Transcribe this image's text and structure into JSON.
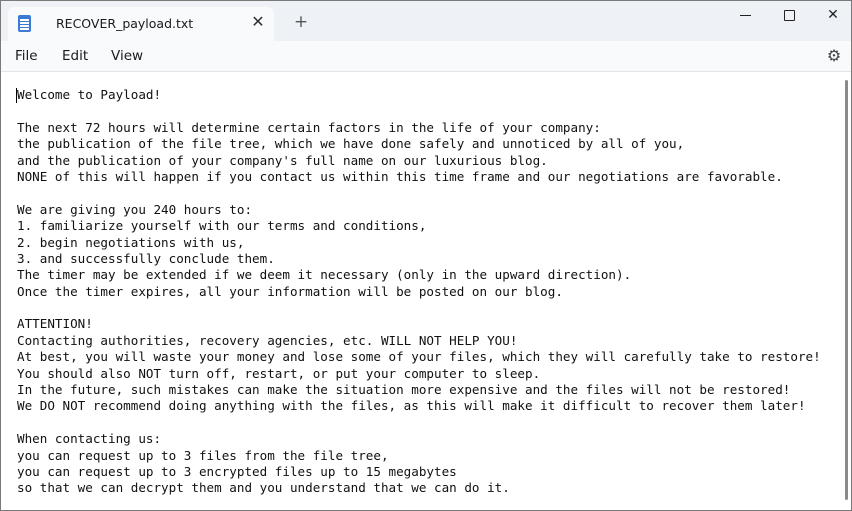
{
  "tab": {
    "title": "RECOVER_payload.txt",
    "close_glyph": "✕",
    "new_tab_glyph": "+"
  },
  "window_controls": {
    "close_glyph": "✕"
  },
  "menu": {
    "file": "File",
    "edit": "Edit",
    "view": "View",
    "settings_glyph": "⚙"
  },
  "document": {
    "lines": [
      "Welcome to Payload!",
      "",
      "The next 72 hours will determine certain factors in the life of your company:",
      "the publication of the file tree, which we have done safely and unnoticed by all of you,",
      "and the publication of your company's full name on our luxurious blog.",
      "NONE of this will happen if you contact us within this time frame and our negotiations are favorable.",
      "",
      "We are giving you 240 hours to:",
      "1. familiarize yourself with our terms and conditions,",
      "2. begin negotiations with us,",
      "3. and successfully conclude them.",
      "The timer may be extended if we deem it necessary (only in the upward direction).",
      "Once the timer expires, all your information will be posted on our blog.",
      "",
      "ATTENTION!",
      "Contacting authorities, recovery agencies, etc. WILL NOT HELP YOU!",
      "At best, you will waste your money and lose some of your files, which they will carefully take to restore!",
      "You should also NOT turn off, restart, or put your computer to sleep.",
      "In the future, such mistakes can make the situation more expensive and the files will not be restored!",
      "We DO NOT recommend doing anything with the files, as this will make it difficult to recover them later!",
      "",
      "When contacting us:",
      "you can request up to 3 files from the file tree,",
      "you can request up to 3 encrypted files up to 15 megabytes",
      "so that we can decrypt them and you understand that we can do it."
    ]
  }
}
